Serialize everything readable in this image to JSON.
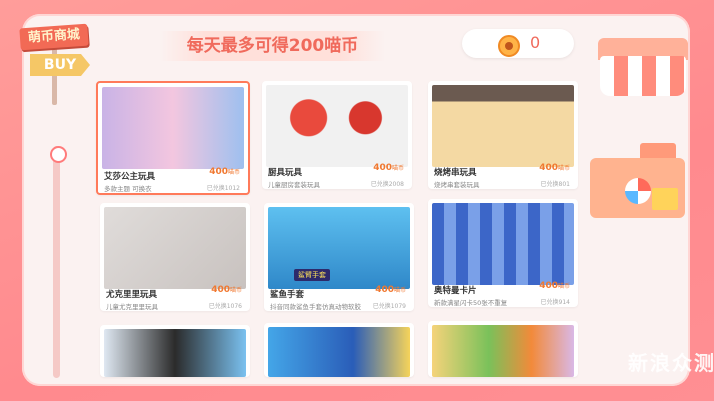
{
  "header": {
    "shop_sign": "萌币商城",
    "buy_sign": "BUY",
    "banner_title": "每天最多可得200喵币",
    "coin_balance": "0"
  },
  "products": [
    {
      "name": "艾莎公主玩具",
      "desc": "多款主题 可换衣",
      "price": "400",
      "unit": "喵币",
      "redeemed": "已兑换1012",
      "img_color": "#cbb7e8"
    },
    {
      "name": "厨具玩具",
      "desc": "儿童厨房套装玩具",
      "price": "400",
      "unit": "喵币",
      "redeemed": "已兑换2008",
      "img_color": "#e94a3d"
    },
    {
      "name": "烧烤串玩具",
      "desc": "烧烤串套装玩具",
      "price": "400",
      "unit": "喵币",
      "redeemed": "已兑换801",
      "img_color": "#f4d9a3"
    },
    {
      "name": "尤克里里玩具",
      "desc": "儿童尤克里里玩具",
      "price": "400",
      "unit": "喵币",
      "redeemed": "已兑换1076",
      "img_color": "#d8d4d2"
    },
    {
      "name": "鲨鱼手套",
      "desc": "抖音同款鲨鱼手套仿真动物软胶",
      "price": "400",
      "unit": "喵币",
      "redeemed": "已兑换1079",
      "img_color": "#4fb4e9"
    },
    {
      "name": "奥特曼卡片",
      "desc": "新款满星闪卡50张不重复",
      "price": "400",
      "unit": "喵币",
      "redeemed": "已兑换914",
      "img_color": "#3c66c8"
    },
    {
      "name": "",
      "desc": "",
      "price": "",
      "unit": "",
      "redeemed": "",
      "img_color": "#e7eef5"
    },
    {
      "name": "",
      "desc": "",
      "price": "",
      "unit": "",
      "redeemed": "",
      "img_color": "#44a6e8"
    },
    {
      "name": "",
      "desc": "",
      "price": "",
      "unit": "",
      "redeemed": "",
      "img_color": "#f5d37a"
    }
  ],
  "overlay": {
    "shark_tag": "鲨臂手套",
    "watermark": "新浪众测"
  }
}
